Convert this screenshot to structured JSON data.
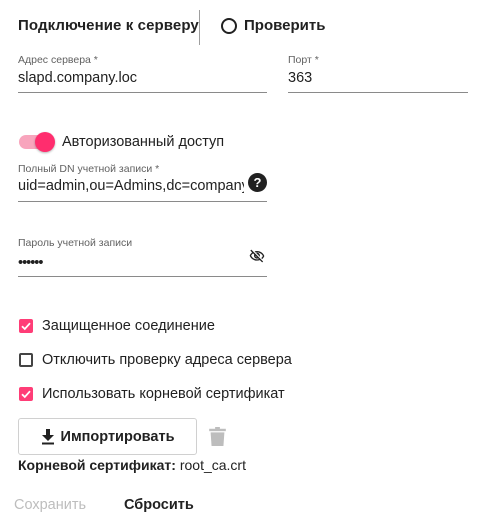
{
  "header": {
    "title": "Подключение к серверу",
    "check_label": "Проверить"
  },
  "server": {
    "address_label": "Адрес сервера *",
    "address_value": "slapd.company.loc",
    "port_label": "Порт *",
    "port_value": "363"
  },
  "auth": {
    "toggle_label": "Авторизованный доступ",
    "toggle_on": true,
    "dn_label": "Полный DN учетной записи *",
    "dn_value": "uid=admin,ou=Admins,dc=company,dc=loc",
    "password_label": "Пароль учетной записи",
    "password_value": "••••••"
  },
  "options": {
    "secure_label": "Защищенное соединение",
    "secure_checked": true,
    "skip_verify_label": "Отключить проверку адреса сервера",
    "skip_verify_checked": false,
    "use_root_cert_label": "Использовать корневой сертификат",
    "use_root_cert_checked": true
  },
  "certificate": {
    "import_label": "Импортировать",
    "root_cert_label": "Корневой сертификат:",
    "root_cert_value": "root_ca.crt"
  },
  "footer": {
    "save_label": "Сохранить",
    "reset_label": "Сбросить"
  },
  "colors": {
    "accent": "#ff3d77",
    "toggle_track": "#f8a5bd",
    "disabled_text": "#bdbdbd"
  }
}
